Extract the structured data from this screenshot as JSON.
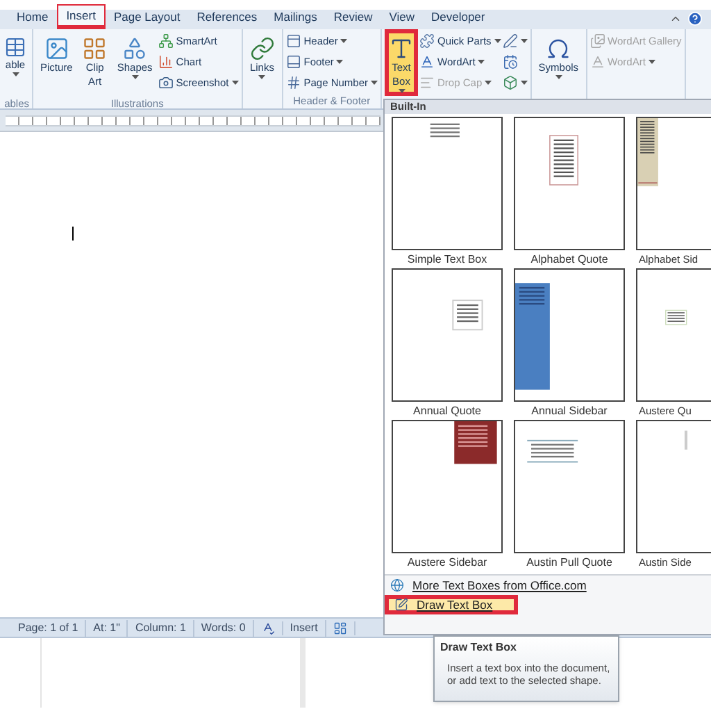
{
  "tabs": [
    {
      "label": "Home",
      "selected": false,
      "highlighted": false
    },
    {
      "label": "Insert",
      "selected": true,
      "highlighted": true
    },
    {
      "label": "Page Layout",
      "selected": false,
      "highlighted": false
    },
    {
      "label": "References",
      "selected": false,
      "highlighted": false
    },
    {
      "label": "Mailings",
      "selected": false,
      "highlighted": false
    },
    {
      "label": "Review",
      "selected": false,
      "highlighted": false
    },
    {
      "label": "View",
      "selected": false,
      "highlighted": false
    },
    {
      "label": "Developer",
      "selected": false,
      "highlighted": false
    }
  ],
  "ribbon": {
    "groups": [
      {
        "label": "ables",
        "items": [
          {
            "kind": "large",
            "lines": [
              "able"
            ],
            "menu": true,
            "highlighted": false
          }
        ]
      },
      {
        "label": "Illustrations",
        "items": [
          {
            "kind": "large",
            "lines": [
              "Picture"
            ],
            "menu": false,
            "highlighted": false
          },
          {
            "kind": "large",
            "lines": [
              "Clip",
              "Art"
            ],
            "menu": false,
            "highlighted": false
          },
          {
            "kind": "large",
            "lines": [
              "Shapes"
            ],
            "menu": true,
            "highlighted": false
          },
          {
            "kind": "stack",
            "items": [
              {
                "label": "SmartArt",
                "menu": false,
                "disabled": false
              },
              {
                "label": "Chart",
                "menu": false,
                "disabled": false
              },
              {
                "label": "Screenshot",
                "menu": true,
                "disabled": false
              }
            ]
          }
        ]
      },
      {
        "items": [
          {
            "kind": "large",
            "lines": [
              "Links"
            ],
            "menu": true,
            "highlighted": false
          }
        ]
      },
      {
        "label": "Header & Footer",
        "items": [
          {
            "kind": "stack",
            "items": [
              {
                "label": "Header",
                "menu": true,
                "disabled": false
              },
              {
                "label": "Footer",
                "menu": true,
                "disabled": false
              },
              {
                "label": "Page Number",
                "menu": true,
                "disabled": false
              }
            ]
          }
        ]
      },
      {
        "items": [
          {
            "kind": "large",
            "lines": [
              "Text",
              "Box"
            ],
            "menu": true,
            "highlighted": true
          },
          {
            "kind": "stack",
            "items": [
              {
                "label": "Quick Parts",
                "menu": true,
                "disabled": false
              },
              {
                "label": "WordArt",
                "menu": true,
                "disabled": false
              },
              {
                "label": "Drop Cap",
                "menu": true,
                "disabled": true
              }
            ]
          },
          {
            "kind": "stack",
            "items": [
              {
                "menu": true,
                "disabled": false
              },
              {
                "menu": false,
                "disabled": false
              },
              {
                "menu": true,
                "disabled": false
              }
            ]
          }
        ]
      },
      {
        "items": [
          {
            "kind": "large",
            "lines": [
              "Symbols"
            ],
            "menu": true,
            "highlighted": false
          }
        ]
      },
      {
        "items": [
          {
            "kind": "stack",
            "items": [
              {
                "label": "WordArt Gallery",
                "menu": false,
                "disabled": true
              },
              {
                "label": "WordArt",
                "menu": true,
                "disabled": true
              }
            ]
          }
        ]
      }
    ]
  },
  "gallery": {
    "heading": "Built-In",
    "items": [
      {
        "label": "Simple Text Box"
      },
      {
        "label": "Alphabet Quote"
      },
      {
        "label": "Alphabet Sid"
      },
      {
        "label": "Annual Quote"
      },
      {
        "label": "Annual Sidebar"
      },
      {
        "label": "Austere Qu"
      },
      {
        "label": "Austere Sidebar"
      },
      {
        "label": "Austin Pull Quote"
      },
      {
        "label": "Austin Side"
      }
    ]
  },
  "menu_items": [
    {
      "label": "More Text Boxes from Office.com",
      "highlighted": false,
      "selected": false
    },
    {
      "label": "Draw Text Box",
      "highlighted": true,
      "selected": true
    }
  ],
  "tooltip": {
    "title": "Draw Text Box",
    "text": "Insert a text box into the document, or add text to the selected shape."
  },
  "status_bar": [
    {
      "kind": "text",
      "label": "Page: 1 of 1"
    },
    {
      "kind": "text",
      "label": "At: 1\""
    },
    {
      "kind": "text",
      "label": "Column: 1"
    },
    {
      "kind": "text",
      "label": "Words: 0"
    },
    {
      "kind": "icon"
    },
    {
      "kind": "text",
      "label": "Insert"
    },
    {
      "kind": "icon"
    }
  ]
}
